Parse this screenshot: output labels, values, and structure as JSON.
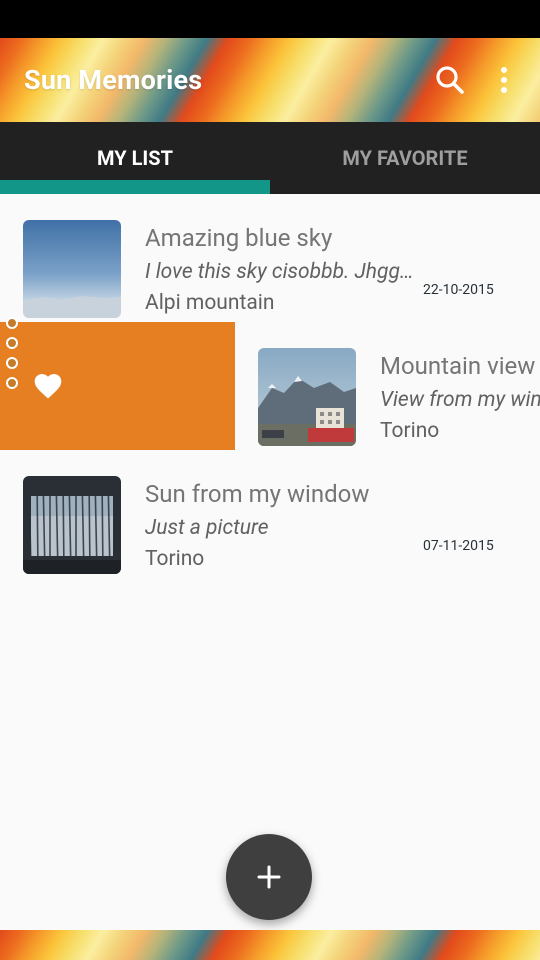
{
  "app_bar": {
    "title": "Sun Memories",
    "search_icon": "search-icon",
    "more_icon": "more-vert-icon"
  },
  "tabs": [
    {
      "label": "MY LIST",
      "selected": true
    },
    {
      "label": "MY FAVORITE",
      "selected": false
    }
  ],
  "accent_color": "#129688",
  "swipe_color": "#e67e22",
  "list": [
    {
      "title": "Amazing blue sky",
      "description": "I love this sky cisobbb. Jhgg…",
      "place": "Alpi mountain",
      "date": "22-10-2015"
    },
    {
      "title": "Mountain view",
      "description": "View from my window",
      "place": "Torino",
      "date": ""
    },
    {
      "title": "Sun from my window",
      "description": "Just a picture",
      "place": "Torino",
      "date": "07-11-2015"
    }
  ],
  "swipe_action": {
    "icon": "heart-icon"
  },
  "fab": {
    "icon": "plus-icon"
  }
}
